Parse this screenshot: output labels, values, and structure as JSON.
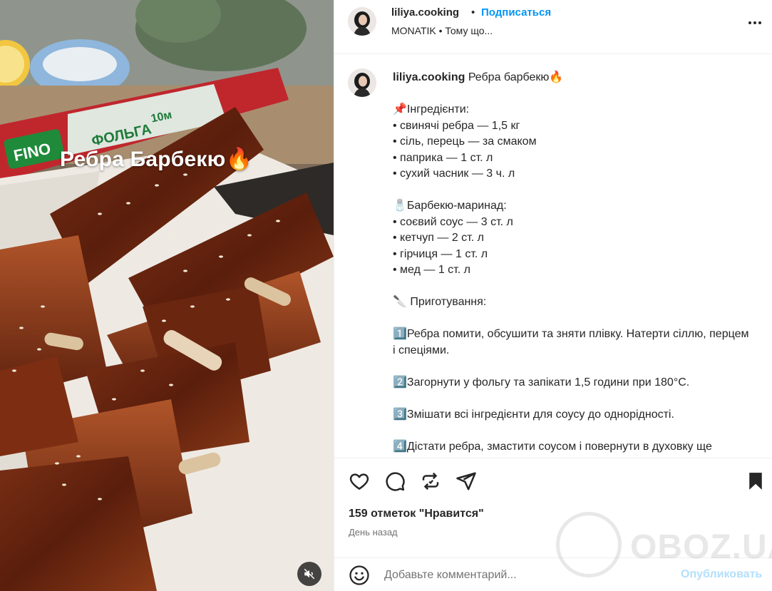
{
  "media": {
    "overlay_title": "Ребра Барбекю🔥",
    "package_brand": "FINO",
    "package_product": "ФОЛЬГА",
    "package_size": "10м",
    "mute_icon": "muted-speaker-icon"
  },
  "post": {
    "username": "liliya.cooking",
    "separator": "•",
    "follow_label": "Подписаться",
    "music": "MONATIK • Тому що...",
    "more_icon": "more-horizontal-icon"
  },
  "caption": {
    "username": "liliya.cooking",
    "title": "Ребра барбекю🔥",
    "lines": [
      "📌Інгредієнти:",
      "• свинячі ребра — 1,5 кг",
      "• сіль, перець — за смаком",
      "• паприка — 1 ст. л",
      "• сухий часник — 3 ч. л",
      "",
      "🧂Барбекю-маринад:",
      "• соєвий соус — 3 ст. л",
      "• кетчуп — 2 ст. л",
      "• гірчиця — 1 ст. л",
      "• мед — 1 ст. л",
      "",
      "🔪 Приготування:",
      "",
      "1️⃣Ребра помити, обсушити та зняти плівку. Натерти сіллю, перцем і спеціями.",
      "",
      "2️⃣Загорнути у фольгу та запікати 1,5 години при 180°С.",
      "",
      "3️⃣Змішати всі інгредієнти для соусу до однорідності.",
      "",
      "4️⃣Дістати ребра, змастити соусом і повернути в духовку ще"
    ]
  },
  "actions": {
    "like_icon": "heart-icon",
    "comment_icon": "comment-icon",
    "repost_icon": "repost-icon",
    "share_icon": "send-icon",
    "save_icon": "bookmark-icon",
    "likes_text": "159 отметок \"Нравится\"",
    "time_text": "День назад"
  },
  "comment": {
    "emoji_icon": "emoji-icon",
    "placeholder": "Добавьте комментарий...",
    "publish_label": "Опубликовать"
  },
  "watermark": {
    "text": "OBOZ.UA"
  },
  "colors": {
    "accent": "#0095f6",
    "publish_disabled": "#b2dffc",
    "text": "#262626",
    "muted": "#737373",
    "divider": "#efefef"
  }
}
